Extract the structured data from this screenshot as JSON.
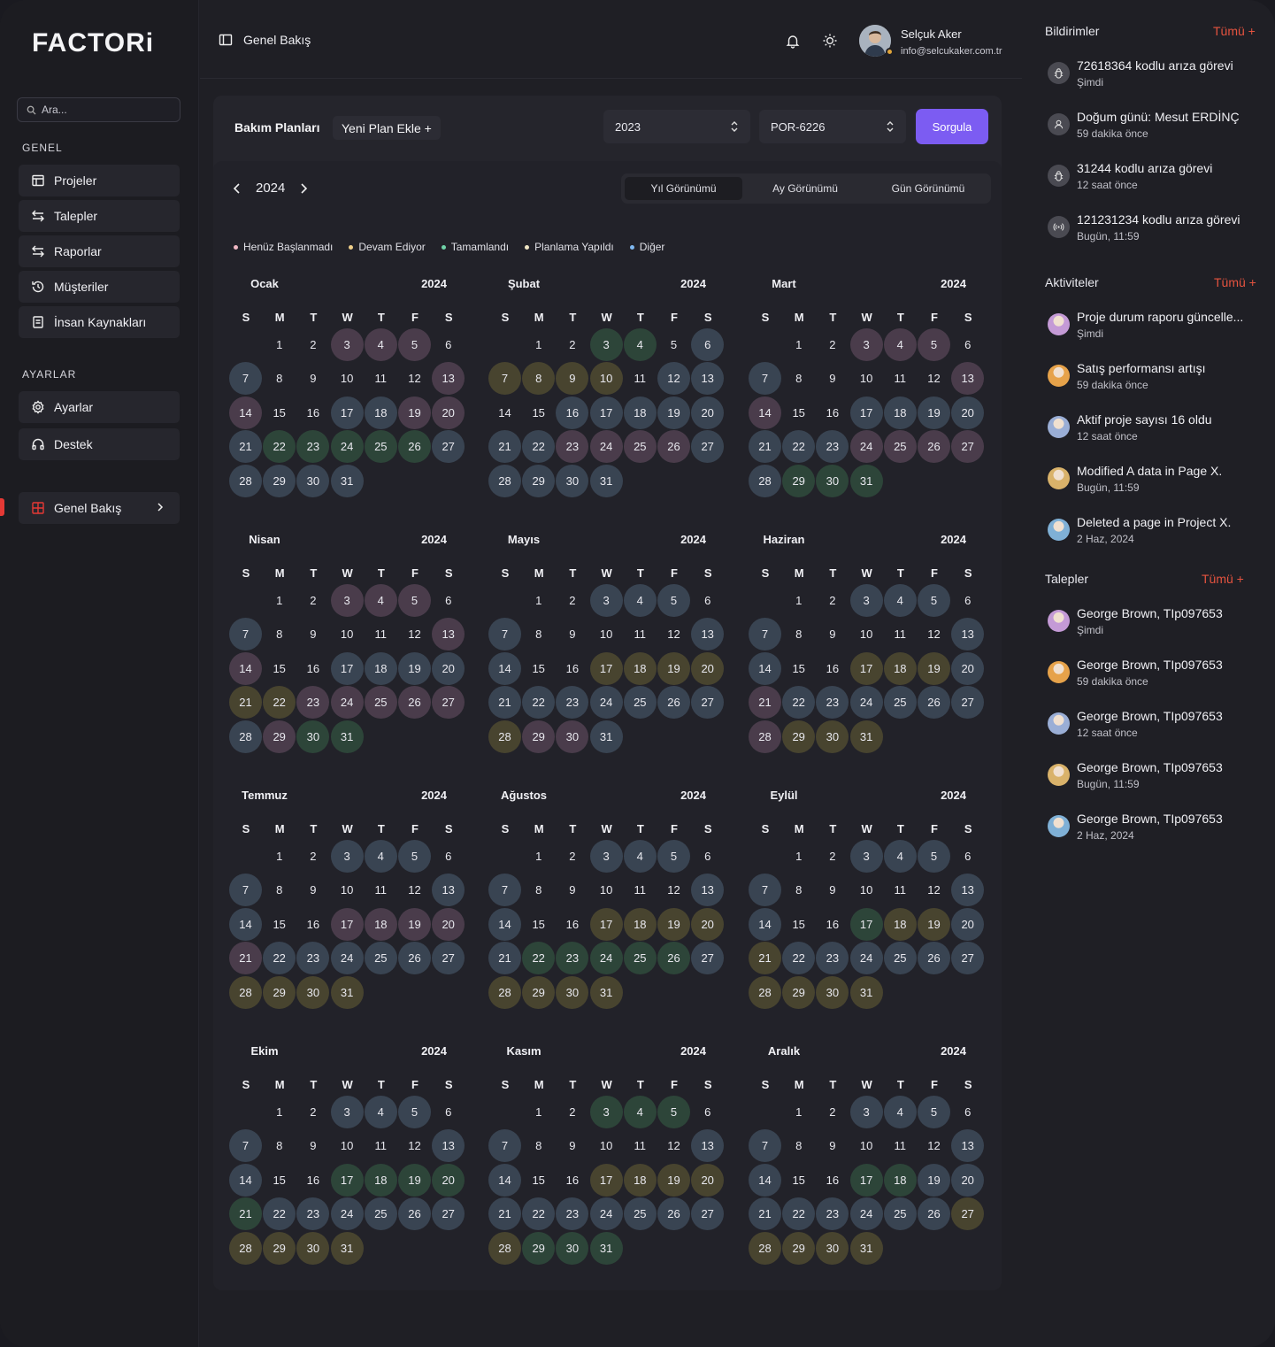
{
  "brand": {
    "name": "FACTORi",
    "accent": "#e53935",
    "purple": "#7c5cf2"
  },
  "search": {
    "placeholder": "Ara..."
  },
  "sidebar": {
    "genel_label": "GENEL",
    "ayarlar_label": "AYARLAR",
    "items": [
      {
        "label": "Projeler",
        "icon": "layout-icon"
      },
      {
        "label": "Talepler",
        "icon": "arrows-icon"
      },
      {
        "label": "Raporlar",
        "icon": "arrows-icon"
      },
      {
        "label": "Müşteriler",
        "icon": "history-icon"
      },
      {
        "label": "İnsan Kaynakları",
        "icon": "document-icon"
      }
    ],
    "settings_items": [
      {
        "label": "Ayarlar",
        "icon": "gear-icon"
      },
      {
        "label": "Destek",
        "icon": "headphones-icon"
      }
    ],
    "active_item": {
      "label": "Genel Bakış",
      "icon": "grid-icon"
    }
  },
  "header": {
    "breadcrumb": "Genel Bakış",
    "user": {
      "name": "Selçuk Aker",
      "email": "info@selcukaker.com.tr"
    }
  },
  "main": {
    "title": "Bakım Planları",
    "add_plan": "Yeni Plan Ekle +",
    "year_select": "2023",
    "code_select": "POR-6226",
    "query_button": "Sorgula",
    "current_year": "2024",
    "view_tabs": [
      "Yıl Görünümü",
      "Ay Görünümü",
      "Gün Görünümü"
    ],
    "active_tab": 0,
    "legend": [
      {
        "label": "Henüz Başlanmadı",
        "color": "#f0b8c4"
      },
      {
        "label": "Devam Ediyor",
        "color": "#f0d08a"
      },
      {
        "label": "Tamamlandı",
        "color": "#6fd3a8"
      },
      {
        "label": "Planlama Yapıldı",
        "color": "#f0e6c4"
      },
      {
        "label": "Diğer",
        "color": "#7fb8f0"
      }
    ],
    "weekdays": [
      "S",
      "M",
      "T",
      "W",
      "T",
      "F",
      "S"
    ],
    "status_colors": {
      "p": "#4a3c4b",
      "y": "#48442f",
      "g": "#2d4539",
      "b": "#394452",
      "n": "#2f2f37"
    },
    "months": [
      {
        "name": "Ocak",
        "year": "2024",
        "status": "nnpppnbnnnnnppnnbbppbgggggbbbbbb"
      },
      {
        "name": "Şubat",
        "year": "2024",
        "status": "nnggnbyyyynbbnnbbbbbbbppppbbbbbb"
      },
      {
        "name": "Mart",
        "year": "2024",
        "status": "nnpppnbnnnnnppnnbbbbbbbppppbggggg"
      },
      {
        "name": "Nisan",
        "year": "2024",
        "status": "nnpppnbnnnnnppnnbbbbyypppppbpgggg"
      },
      {
        "name": "Mayıs",
        "year": "2024",
        "status": "nnbbbnbnnnnnbbnnyyyybbbbbbbyppbbb"
      },
      {
        "name": "Haziran",
        "year": "2024",
        "status": "nnbbbnbnnnnnbbnnyyybpbbbbbbpyyyyy"
      },
      {
        "name": "Temmuz",
        "year": "2024",
        "status": "nnbbbnbnnnnnbbnnpppppbbbbbbyyyyyy"
      },
      {
        "name": "Ağustos",
        "year": "2024",
        "status": "nnbbbnbnnnnnbbnnyyyybgggggbyyyyy"
      },
      {
        "name": "Eylül",
        "year": "2024",
        "status": "nnbbbnbnnnnnbbnngyybybbbbbbyyyyy"
      },
      {
        "name": "Ekim",
        "year": "2024",
        "status": "nnbbbnbnnnnnbbnngggggbbbbbbyyyyy"
      },
      {
        "name": "Kasım",
        "year": "2024",
        "status": "nngggnbnnnnnbbnnyyyybbbbbbbyggggg"
      },
      {
        "name": "Aralık",
        "year": "2024",
        "status": "nnbbbnbnnnnnbbnnggbbbbbbbbyyyyyy"
      }
    ]
  },
  "right": {
    "notifications": {
      "title": "Bildirimler",
      "all": "Tümü +",
      "items": [
        {
          "title": "72618364 kodlu arıza görevi",
          "time": "Şimdi",
          "icon": "bug-icon"
        },
        {
          "title": "Doğum günü: Mesut ERDİNÇ",
          "time": "59 dakika önce",
          "icon": "user-icon"
        },
        {
          "title": "31244 kodlu arıza görevi",
          "time": "12 saat önce",
          "icon": "bug-icon"
        },
        {
          "title": "121231234 kodlu arıza görevi",
          "time": "Bugün, 11:59",
          "icon": "broadcast-icon"
        }
      ]
    },
    "activities": {
      "title": "Aktiviteler",
      "all": "Tümü +",
      "items": [
        {
          "title": "Proje durum raporu güncelle...",
          "time": "Şimdi",
          "color": "#c49ad6"
        },
        {
          "title": "Satış performansı artışı",
          "time": "59 dakika önce",
          "color": "#e6a24a"
        },
        {
          "title": "Aktif proje sayısı 16 oldu",
          "time": "12 saat önce",
          "color": "#9aaed6"
        },
        {
          "title": "Modified A data in Page X.",
          "time": "Bugün, 11:59",
          "color": "#d9b26a"
        },
        {
          "title": "Deleted a page in Project X.",
          "time": "2 Haz, 2024",
          "color": "#7fb0d6"
        }
      ]
    },
    "requests": {
      "title": "Talepler",
      "all": "Tümü +",
      "items": [
        {
          "title": "George Brown, TIp097653",
          "time": "Şimdi",
          "color": "#c49ad6"
        },
        {
          "title": "George Brown, TIp097653",
          "time": "59 dakika önce",
          "color": "#e6a24a"
        },
        {
          "title": "George Brown, TIp097653",
          "time": "12 saat önce",
          "color": "#9aaed6"
        },
        {
          "title": "George Brown, TIp097653",
          "time": "Bugün, 11:59",
          "color": "#d9b26a"
        },
        {
          "title": "George Brown, TIp097653",
          "time": "2 Haz, 2024",
          "color": "#7fb0d6"
        }
      ]
    }
  }
}
